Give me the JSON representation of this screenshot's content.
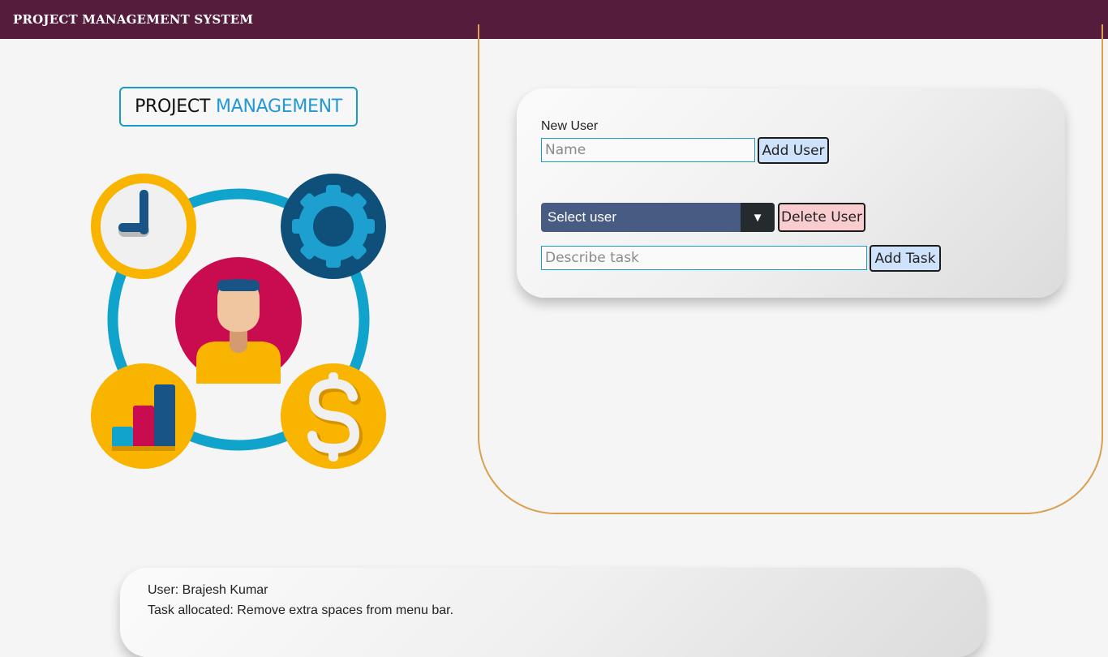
{
  "header": {
    "title": "PROJECT MANAGEMENT SYSTEM",
    "background": "#561c3c"
  },
  "logo": {
    "word_1": "PROJECT",
    "word_2": "MANAGEMENT",
    "accent": "#2398d6"
  },
  "illustration": {
    "icons": [
      "clock-icon",
      "gear-icon",
      "person-icon",
      "bar-chart-icon",
      "dollar-icon"
    ]
  },
  "form": {
    "new_user_label": "New User",
    "name_placeholder": "Name",
    "add_user_label": "Add User",
    "select_user_value": "Select user",
    "select_arrow": "▼",
    "delete_user_label": "Delete User",
    "task_placeholder": "Describe task",
    "add_task_label": "Add Task"
  },
  "task_card": {
    "user_line": "User: Brajesh Kumar",
    "task_line": "Task allocated: Remove extra spaces from menu bar."
  }
}
